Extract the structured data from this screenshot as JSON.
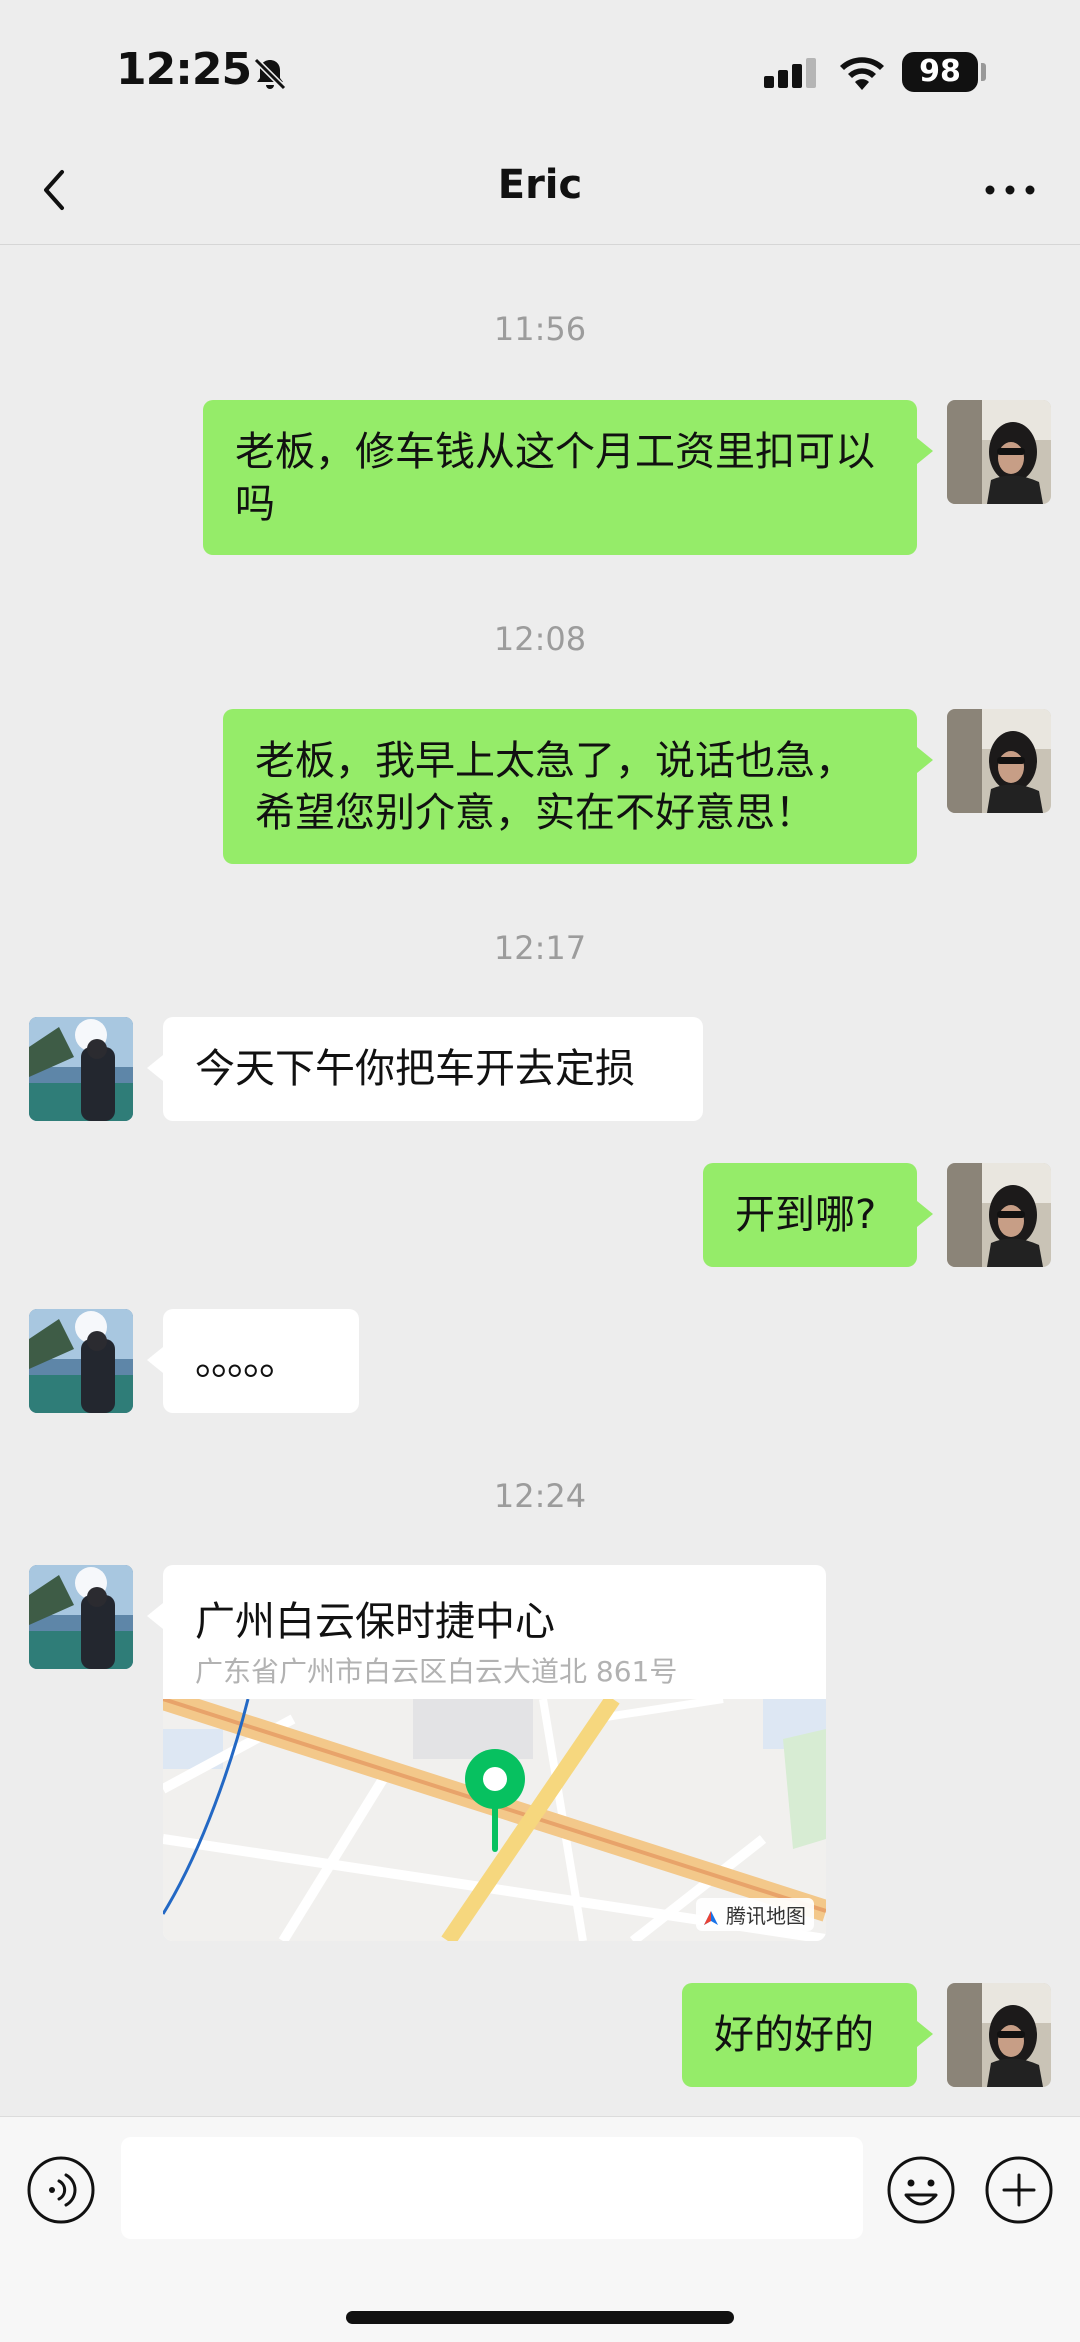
{
  "status_bar": {
    "time": "12:25",
    "battery": "98"
  },
  "header": {
    "title": "Eric"
  },
  "messages": [
    {
      "type": "timestamp",
      "text": "11:56"
    },
    {
      "type": "text",
      "from": "me",
      "text": "老板，修车钱从这个月工资里扣可以吗"
    },
    {
      "type": "timestamp",
      "text": "12:08"
    },
    {
      "type": "text",
      "from": "me",
      "text": "老板，我早上太急了，说话也急，希望您别介意，实在不好意思！"
    },
    {
      "type": "timestamp",
      "text": "12:17"
    },
    {
      "type": "text",
      "from": "other",
      "text": "今天下午你把车开去定损"
    },
    {
      "type": "text",
      "from": "me",
      "text": "开到哪?"
    },
    {
      "type": "text",
      "from": "other",
      "text": "。。。。。"
    },
    {
      "type": "timestamp",
      "text": "12:24"
    },
    {
      "type": "location",
      "from": "other",
      "name": "广州白云保时捷中心",
      "address": "广东省广州市白云区白云大道北 861号",
      "map_provider": "腾讯地图"
    },
    {
      "type": "text",
      "from": "me",
      "text": "好的好的"
    }
  ],
  "input_bar": {
    "placeholder": ""
  },
  "colors": {
    "my_bubble": "#95ec69",
    "other_bubble": "#ffffff",
    "background": "#ededed",
    "pin": "#07c160"
  },
  "icons": [
    "bell-slash-icon",
    "cellular-signal-icon",
    "wifi-icon",
    "back-chevron-icon",
    "more-icon",
    "voice-icon",
    "emoji-icon",
    "plus-icon",
    "map-pin-icon",
    "tencent-map-logo-icon"
  ]
}
